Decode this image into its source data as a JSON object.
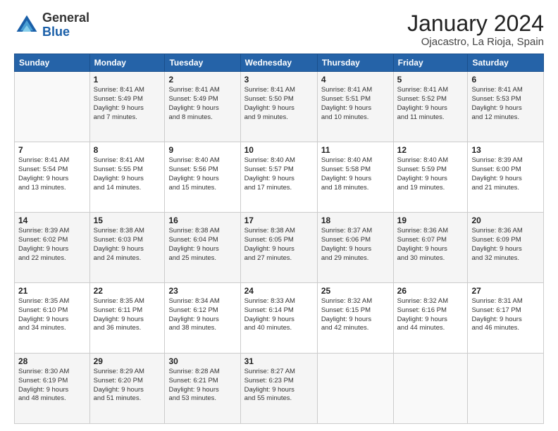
{
  "header": {
    "logo": {
      "general": "General",
      "blue": "Blue"
    },
    "month_title": "January 2024",
    "location": "Ojacastro, La Rioja, Spain"
  },
  "calendar": {
    "days_of_week": [
      "Sunday",
      "Monday",
      "Tuesday",
      "Wednesday",
      "Thursday",
      "Friday",
      "Saturday"
    ],
    "weeks": [
      [
        {
          "day": "",
          "content": ""
        },
        {
          "day": "1",
          "content": "Sunrise: 8:41 AM\nSunset: 5:49 PM\nDaylight: 9 hours\nand 7 minutes."
        },
        {
          "day": "2",
          "content": "Sunrise: 8:41 AM\nSunset: 5:49 PM\nDaylight: 9 hours\nand 8 minutes."
        },
        {
          "day": "3",
          "content": "Sunrise: 8:41 AM\nSunset: 5:50 PM\nDaylight: 9 hours\nand 9 minutes."
        },
        {
          "day": "4",
          "content": "Sunrise: 8:41 AM\nSunset: 5:51 PM\nDaylight: 9 hours\nand 10 minutes."
        },
        {
          "day": "5",
          "content": "Sunrise: 8:41 AM\nSunset: 5:52 PM\nDaylight: 9 hours\nand 11 minutes."
        },
        {
          "day": "6",
          "content": "Sunrise: 8:41 AM\nSunset: 5:53 PM\nDaylight: 9 hours\nand 12 minutes."
        }
      ],
      [
        {
          "day": "7",
          "content": "Sunrise: 8:41 AM\nSunset: 5:54 PM\nDaylight: 9 hours\nand 13 minutes."
        },
        {
          "day": "8",
          "content": "Sunrise: 8:41 AM\nSunset: 5:55 PM\nDaylight: 9 hours\nand 14 minutes."
        },
        {
          "day": "9",
          "content": "Sunrise: 8:40 AM\nSunset: 5:56 PM\nDaylight: 9 hours\nand 15 minutes."
        },
        {
          "day": "10",
          "content": "Sunrise: 8:40 AM\nSunset: 5:57 PM\nDaylight: 9 hours\nand 17 minutes."
        },
        {
          "day": "11",
          "content": "Sunrise: 8:40 AM\nSunset: 5:58 PM\nDaylight: 9 hours\nand 18 minutes."
        },
        {
          "day": "12",
          "content": "Sunrise: 8:40 AM\nSunset: 5:59 PM\nDaylight: 9 hours\nand 19 minutes."
        },
        {
          "day": "13",
          "content": "Sunrise: 8:39 AM\nSunset: 6:00 PM\nDaylight: 9 hours\nand 21 minutes."
        }
      ],
      [
        {
          "day": "14",
          "content": "Sunrise: 8:39 AM\nSunset: 6:02 PM\nDaylight: 9 hours\nand 22 minutes."
        },
        {
          "day": "15",
          "content": "Sunrise: 8:38 AM\nSunset: 6:03 PM\nDaylight: 9 hours\nand 24 minutes."
        },
        {
          "day": "16",
          "content": "Sunrise: 8:38 AM\nSunset: 6:04 PM\nDaylight: 9 hours\nand 25 minutes."
        },
        {
          "day": "17",
          "content": "Sunrise: 8:38 AM\nSunset: 6:05 PM\nDaylight: 9 hours\nand 27 minutes."
        },
        {
          "day": "18",
          "content": "Sunrise: 8:37 AM\nSunset: 6:06 PM\nDaylight: 9 hours\nand 29 minutes."
        },
        {
          "day": "19",
          "content": "Sunrise: 8:36 AM\nSunset: 6:07 PM\nDaylight: 9 hours\nand 30 minutes."
        },
        {
          "day": "20",
          "content": "Sunrise: 8:36 AM\nSunset: 6:09 PM\nDaylight: 9 hours\nand 32 minutes."
        }
      ],
      [
        {
          "day": "21",
          "content": "Sunrise: 8:35 AM\nSunset: 6:10 PM\nDaylight: 9 hours\nand 34 minutes."
        },
        {
          "day": "22",
          "content": "Sunrise: 8:35 AM\nSunset: 6:11 PM\nDaylight: 9 hours\nand 36 minutes."
        },
        {
          "day": "23",
          "content": "Sunrise: 8:34 AM\nSunset: 6:12 PM\nDaylight: 9 hours\nand 38 minutes."
        },
        {
          "day": "24",
          "content": "Sunrise: 8:33 AM\nSunset: 6:14 PM\nDaylight: 9 hours\nand 40 minutes."
        },
        {
          "day": "25",
          "content": "Sunrise: 8:32 AM\nSunset: 6:15 PM\nDaylight: 9 hours\nand 42 minutes."
        },
        {
          "day": "26",
          "content": "Sunrise: 8:32 AM\nSunset: 6:16 PM\nDaylight: 9 hours\nand 44 minutes."
        },
        {
          "day": "27",
          "content": "Sunrise: 8:31 AM\nSunset: 6:17 PM\nDaylight: 9 hours\nand 46 minutes."
        }
      ],
      [
        {
          "day": "28",
          "content": "Sunrise: 8:30 AM\nSunset: 6:19 PM\nDaylight: 9 hours\nand 48 minutes."
        },
        {
          "day": "29",
          "content": "Sunrise: 8:29 AM\nSunset: 6:20 PM\nDaylight: 9 hours\nand 51 minutes."
        },
        {
          "day": "30",
          "content": "Sunrise: 8:28 AM\nSunset: 6:21 PM\nDaylight: 9 hours\nand 53 minutes."
        },
        {
          "day": "31",
          "content": "Sunrise: 8:27 AM\nSunset: 6:23 PM\nDaylight: 9 hours\nand 55 minutes."
        },
        {
          "day": "",
          "content": ""
        },
        {
          "day": "",
          "content": ""
        },
        {
          "day": "",
          "content": ""
        }
      ]
    ]
  }
}
